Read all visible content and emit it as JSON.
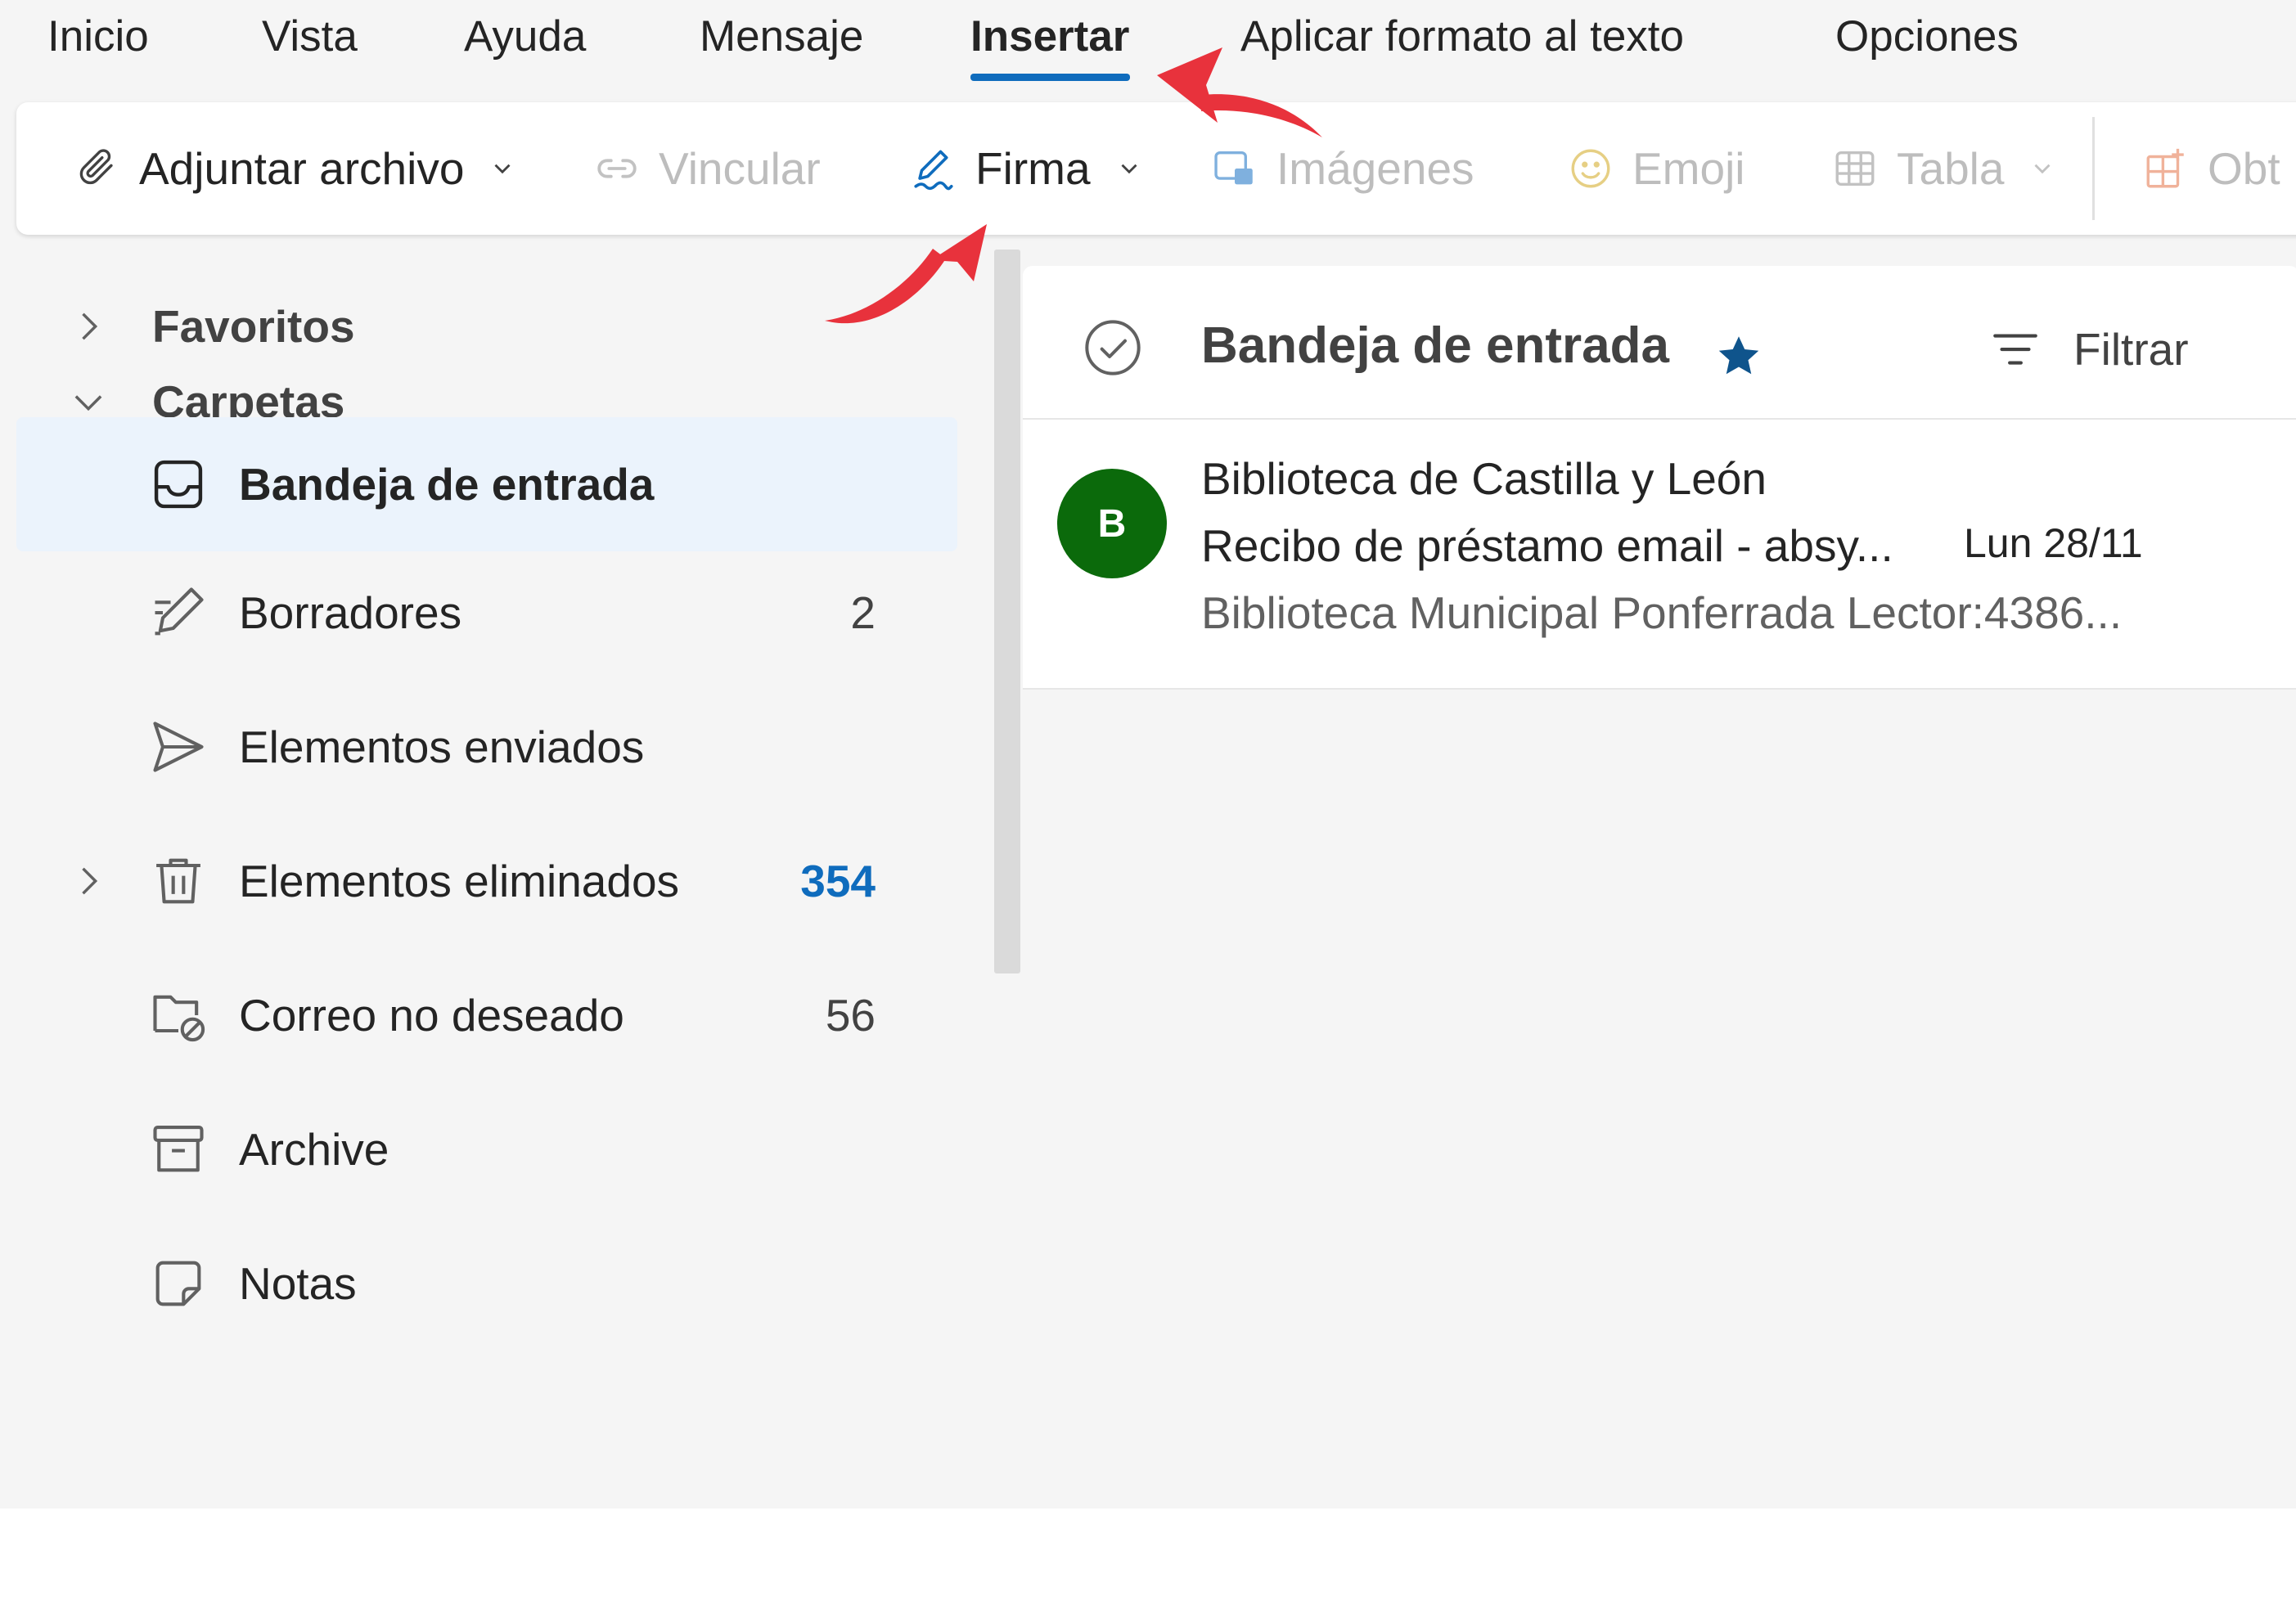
{
  "tabs": [
    {
      "label": "Inicio"
    },
    {
      "label": "Vista"
    },
    {
      "label": "Ayuda"
    },
    {
      "label": "Mensaje"
    },
    {
      "label": "Insertar",
      "active": true
    },
    {
      "label": "Aplicar formato al texto"
    },
    {
      "label": "Opciones"
    }
  ],
  "ribbon": {
    "attach": {
      "label": "Adjuntar archivo",
      "icon": "paperclip-icon"
    },
    "link": {
      "label": "Vincular",
      "icon": "link-icon",
      "disabled": true
    },
    "signature": {
      "label": "Firma",
      "icon": "signature-pen-icon"
    },
    "images": {
      "label": "Imágenes",
      "icon": "image-icon",
      "disabled": true
    },
    "emoji": {
      "label": "Emoji",
      "icon": "emoji-icon",
      "disabled": true
    },
    "table": {
      "label": "Tabla",
      "icon": "table-grid-icon",
      "disabled": true
    },
    "addins": {
      "label": "Obt",
      "icon": "apps-addin-icon",
      "disabled": true
    }
  },
  "sidebar": {
    "favorites": {
      "label": "Favoritos"
    },
    "folders": {
      "label": "Carpetas"
    },
    "items": [
      {
        "label": "Bandeja de entrada",
        "icon": "inbox-icon",
        "selected": true
      },
      {
        "label": "Borradores",
        "icon": "draft-pencil-icon",
        "count": "2"
      },
      {
        "label": "Elementos enviados",
        "icon": "send-icon"
      },
      {
        "label": "Elementos eliminados",
        "icon": "trash-icon",
        "count": "354"
      },
      {
        "label": "Correo no deseado",
        "icon": "junk-folder-icon",
        "count": "56"
      },
      {
        "label": "Archive",
        "icon": "archive-icon"
      },
      {
        "label": "Notas",
        "icon": "note-icon"
      }
    ]
  },
  "mail_list": {
    "title": "Bandeja de entrada",
    "filter_label": "Filtrar",
    "messages": [
      {
        "avatar_letter": "B",
        "sender": "Biblioteca de Castilla y León",
        "subject": "Recibo de préstamo email - absy...",
        "date": "Lun 28/11",
        "preview": "Biblioteca Municipal Ponferrada Lector:4386..."
      }
    ]
  },
  "colors": {
    "accent": "#0f6cbd",
    "avatar": "#0b6a0b",
    "annotation_arrow": "#e8323c",
    "selected_folder": "#ebf3fc"
  }
}
